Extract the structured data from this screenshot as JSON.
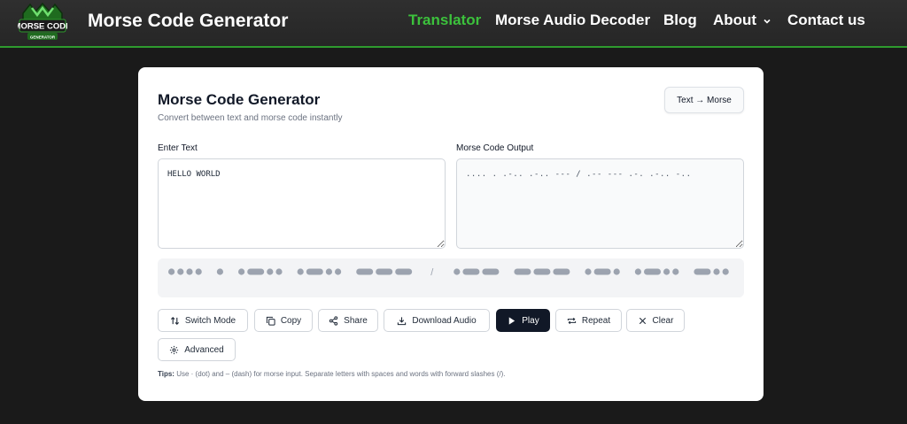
{
  "header": {
    "logo_text": "MORSE CODE",
    "logo_subtext": "GENERATOR",
    "brand": "Morse Code Generator",
    "nav": [
      {
        "label": "Translator",
        "active": true
      },
      {
        "label": "Morse Audio Decoder"
      },
      {
        "label": "Blog"
      },
      {
        "label": "About"
      },
      {
        "label": "Contact us"
      }
    ]
  },
  "card": {
    "title": "Morse Code Generator",
    "subtitle": "Convert between text and morse code instantly",
    "mode_button": "Text → Morse",
    "input_label": "Enter Text",
    "input_value": "HELLO WORLD",
    "output_label": "Morse Code Output",
    "output_value": ".... . .-.. .-.. --- / .-- --- .-. .-.. -..",
    "separator": "/",
    "buttons": {
      "switch_mode": "Switch Mode",
      "copy": "Copy",
      "share": "Share",
      "download_audio": "Download Audio",
      "play": "Play",
      "repeat": "Repeat",
      "clear": "Clear",
      "advanced": "Advanced"
    },
    "tips_label": "Tips:",
    "tips_text": "Use · (dot) and – (dash) for morse input. Separate letters with spaces and words with forward slashes (/)."
  },
  "colors": {
    "accent_green": "#3cc13c",
    "dark_button": "#111827",
    "morse_symbol": "#9ca3af"
  }
}
